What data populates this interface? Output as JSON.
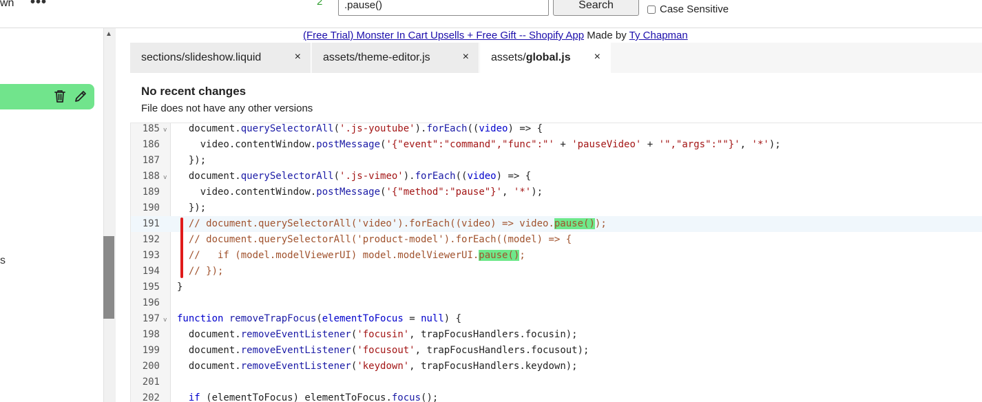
{
  "toolbar": {
    "left_fragment": "wn",
    "more_label": "•••",
    "match_count": "2",
    "search_value": ".pause()",
    "search_button": "Search",
    "case_label": "Case Sensitive"
  },
  "sidebar": {
    "fragment": "s",
    "accent_color": "#71e48c"
  },
  "promo": {
    "link_text": "(Free Trial) Monster In Cart Upsells + Free Gift -- Shopify App",
    "made_by": "Made by",
    "author": "Ty Chapman"
  },
  "tabs": [
    {
      "label": "sections/slideshow.liquid",
      "close": "×"
    },
    {
      "label": "assets/theme-editor.js",
      "close": "×"
    },
    {
      "prefix": "assets/",
      "bold": "global.js",
      "close": "×"
    }
  ],
  "info": {
    "title": "No recent changes",
    "subtitle": "File does not have any other versions"
  },
  "editor": {
    "fold_glyph": "v",
    "lines": [
      {
        "n": "185",
        "html": "  document.<span class=\"fn\">querySelectorAll</span>(<span class=\"str\">'.js-youtube'</span>).<span class=\"fn\">forEach</span>((<span class=\"var\">video</span>) =&gt; {",
        "fold": true
      },
      {
        "n": "186",
        "html": "    video.contentWindow.<span class=\"fn\">postMessage</span>(<span class=\"str\">'{\"event\":\"command\",\"func\":\"'</span> + <span class=\"str\">'pauseVideo'</span> + <span class=\"str\">'\",\"args\":\"\"}'</span>, <span class=\"str\">'*'</span>);"
      },
      {
        "n": "187",
        "html": "  });"
      },
      {
        "n": "188",
        "html": "  document.<span class=\"fn\">querySelectorAll</span>(<span class=\"str\">'.js-vimeo'</span>).<span class=\"fn\">forEach</span>((<span class=\"var\">video</span>) =&gt; {",
        "fold": true
      },
      {
        "n": "189",
        "html": "    video.contentWindow.<span class=\"fn\">postMessage</span>(<span class=\"str\">'{\"method\":\"pause\"}'</span>, <span class=\"str\">'*'</span>);"
      },
      {
        "n": "190",
        "html": "  });"
      },
      {
        "n": "191",
        "html": "  <span class=\"cm\">// document.querySelectorAll('video').forEach((video) =&gt; video.<span class=\"match\">pause()</span>);</span>",
        "hl": true
      },
      {
        "n": "192",
        "html": "  <span class=\"cm\">// document.querySelectorAll('product-model').forEach((model) =&gt; {</span>"
      },
      {
        "n": "193",
        "html": "  <span class=\"cm\">//   if (model.modelViewerUI) model.modelViewerUI.<span class=\"match\">pause()</span>;</span>"
      },
      {
        "n": "194",
        "html": "  <span class=\"cm\">// });</span>"
      },
      {
        "n": "195",
        "html": "}"
      },
      {
        "n": "196",
        "html": ""
      },
      {
        "n": "197",
        "html": "<span class=\"kw2\">function</span> <span class=\"fn\">removeTrapFocus</span>(<span class=\"var\">elementToFocus</span> = <span class=\"kw2\">null</span>) {",
        "fold": true
      },
      {
        "n": "198",
        "html": "  document.<span class=\"fn\">removeEventListener</span>(<span class=\"str\">'focusin'</span>, trapFocusHandlers.focusin);"
      },
      {
        "n": "199",
        "html": "  document.<span class=\"fn\">removeEventListener</span>(<span class=\"str\">'focusout'</span>, trapFocusHandlers.focusout);"
      },
      {
        "n": "200",
        "html": "  document.<span class=\"fn\">removeEventListener</span>(<span class=\"str\">'keydown'</span>, trapFocusHandlers.keydown);"
      },
      {
        "n": "201",
        "html": ""
      },
      {
        "n": "202",
        "html": "  <span class=\"kw2\">if</span> (elementToFocus) elementToFocus.<span class=\"fn\">focus</span>();"
      }
    ]
  }
}
